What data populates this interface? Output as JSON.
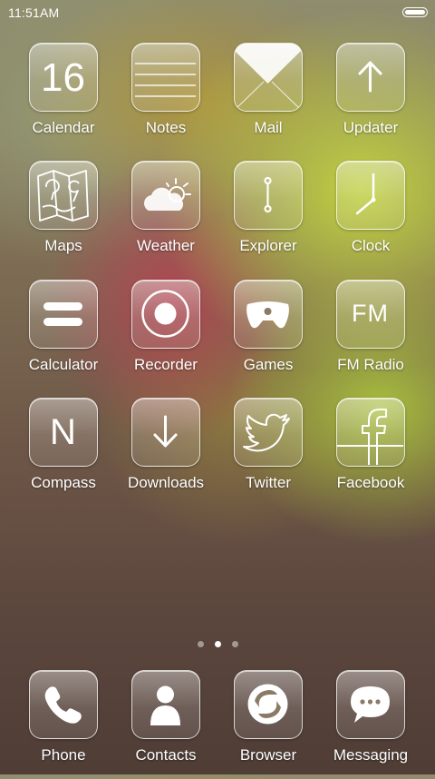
{
  "status_bar": {
    "time": "11:51AM"
  },
  "pages": {
    "count": 3,
    "active_index": 1
  },
  "apps": [
    {
      "label": "Calendar",
      "icon": "calendar-icon",
      "date": "16"
    },
    {
      "label": "Notes",
      "icon": "notes-icon"
    },
    {
      "label": "Mail",
      "icon": "mail-icon"
    },
    {
      "label": "Updater",
      "icon": "arrow-up-icon"
    },
    {
      "label": "Maps",
      "icon": "map-icon"
    },
    {
      "label": "Weather",
      "icon": "weather-icon"
    },
    {
      "label": "Explorer",
      "icon": "explorer-icon"
    },
    {
      "label": "Clock",
      "icon": "clock-icon"
    },
    {
      "label": "Calculator",
      "icon": "calculator-icon"
    },
    {
      "label": "Recorder",
      "icon": "recorder-icon"
    },
    {
      "label": "Games",
      "icon": "gamepad-icon"
    },
    {
      "label": "FM Radio",
      "icon": "radio-icon",
      "icon_text": "FM"
    },
    {
      "label": "Compass",
      "icon": "compass-icon",
      "icon_text": "N"
    },
    {
      "label": "Downloads",
      "icon": "download-icon"
    },
    {
      "label": "Twitter",
      "icon": "twitter-icon"
    },
    {
      "label": "Facebook",
      "icon": "facebook-icon",
      "icon_text": "f"
    }
  ],
  "dock": [
    {
      "label": "Phone",
      "icon": "phone-icon"
    },
    {
      "label": "Contacts",
      "icon": "contacts-icon"
    },
    {
      "label": "Browser",
      "icon": "browser-icon"
    },
    {
      "label": "Messaging",
      "icon": "messaging-icon"
    }
  ]
}
